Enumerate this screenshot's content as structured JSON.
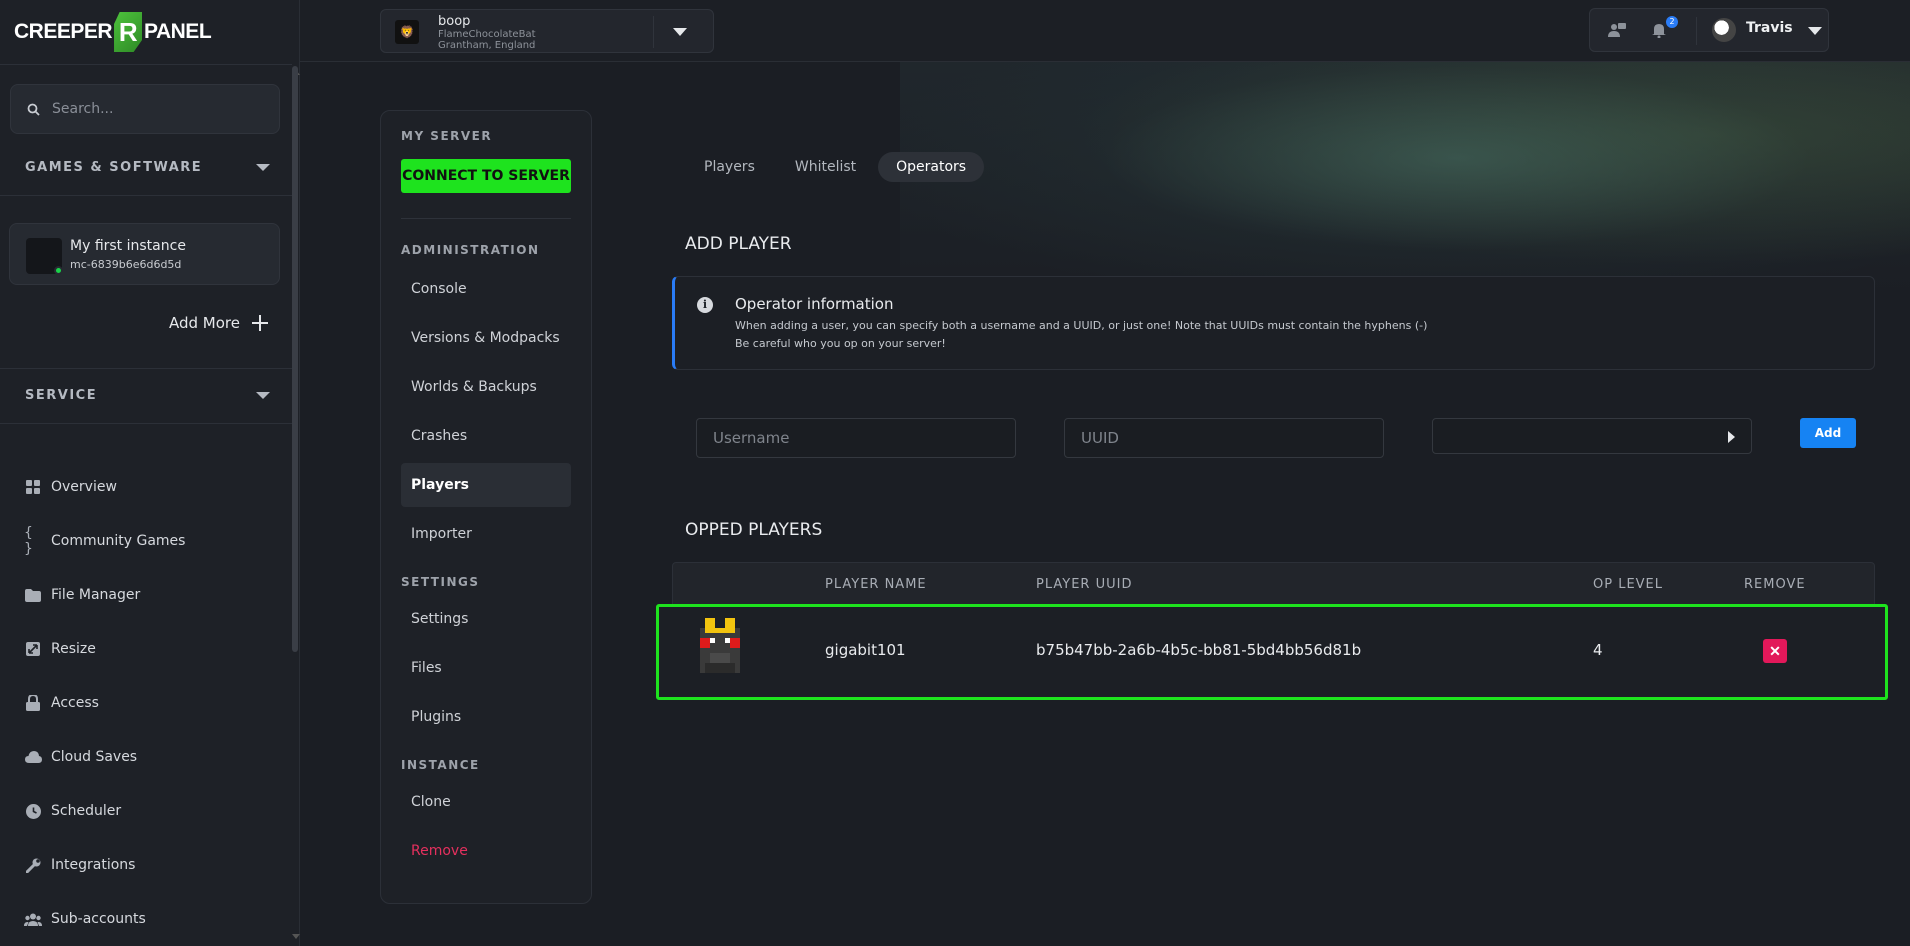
{
  "brand": {
    "logo_left": "CREEPER",
    "logo_mid": "R",
    "logo_right": "PANEL"
  },
  "sidebar": {
    "search_placeholder": "Search...",
    "games_section": "GAMES & SOFTWARE",
    "instance": {
      "name": "My first instance",
      "id": "mc-6839b6e6d6d5d"
    },
    "add_more": "Add More",
    "service_section": "SERVICE",
    "items": [
      {
        "label": "Overview",
        "icon": "grid-icon"
      },
      {
        "label": "Community Games",
        "icon": "braces-icon"
      },
      {
        "label": "File Manager",
        "icon": "folder-icon"
      },
      {
        "label": "Resize",
        "icon": "resize-icon"
      },
      {
        "label": "Access",
        "icon": "lock-icon"
      },
      {
        "label": "Cloud Saves",
        "icon": "cloud-icon"
      },
      {
        "label": "Scheduler",
        "icon": "clock-icon"
      },
      {
        "label": "Integrations",
        "icon": "wrench-icon"
      },
      {
        "label": "Sub-accounts",
        "icon": "users-icon"
      }
    ]
  },
  "topbar": {
    "server": {
      "name": "boop",
      "sub1": "FlameChocolateBat",
      "sub2": "Grantham, England"
    },
    "notifications_count": "2",
    "user_name": "Travis"
  },
  "panel": {
    "my_server": "MY SERVER",
    "connect": "CONNECT TO SERVER",
    "administration": "ADMINISTRATION",
    "admin_items": [
      "Console",
      "Versions & Modpacks",
      "Worlds & Backups",
      "Crashes",
      "Players",
      "Importer"
    ],
    "settings": "SETTINGS",
    "settings_items": [
      "Settings",
      "Files",
      "Plugins"
    ],
    "instance": "INSTANCE",
    "instance_items": [
      "Clone",
      "Remove"
    ]
  },
  "content": {
    "tabs": [
      "Players",
      "Whitelist",
      "Operators"
    ],
    "active_tab": "Operators",
    "add_player_title": "ADD PLAYER",
    "info": {
      "title": "Operator information",
      "line1": "When adding a user, you can specify both a username and a UUID, or just one! Note that UUIDs must contain the hyphens (-)",
      "line2": "Be careful who you op on your server!"
    },
    "username_placeholder": "Username",
    "uuid_placeholder": "UUID",
    "add_button": "Add",
    "opped_title": "OPPED PLAYERS",
    "columns": [
      "PLAYER NAME",
      "PLAYER UUID",
      "OP LEVEL",
      "REMOVE"
    ],
    "rows": [
      {
        "name": "gigabit101",
        "uuid": "b75b47bb-2a6b-4b5c-bb81-5bd4bb56d81b",
        "level": "4",
        "remove": "✕"
      }
    ]
  },
  "colors": {
    "accent_green": "#1ee31e",
    "accent_blue": "#1683f3",
    "danger": "#e2185a"
  }
}
